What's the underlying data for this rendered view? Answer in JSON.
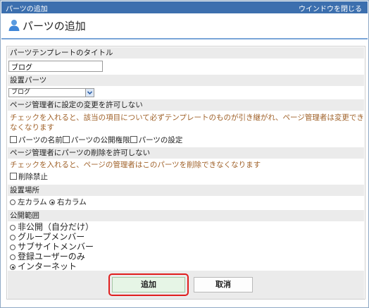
{
  "window": {
    "title": "パーツの追加",
    "close_label": "ウインドウを閉じる"
  },
  "heading": {
    "title": "パーツの追加",
    "icon": "person-icon"
  },
  "form": {
    "template_title_label": "パーツテンプレートのタイトル",
    "template_title_value": "ブログ",
    "part_label": "設置パーツ",
    "part_selected": "ブログ",
    "allow_change_label": "ページ管理者に設定の変更を許可しない",
    "allow_change_note": "チェックを入れると、該当の項目について必ずテンプレートのものが引き継がれ、ページ管理者は変更できなくなります",
    "change_options": [
      {
        "label": "パーツの名前",
        "checked": false
      },
      {
        "label": "パーツの公開権限",
        "checked": false
      },
      {
        "label": "パーツの設定",
        "checked": false
      }
    ],
    "allow_delete_label": "ページ管理者にパーツの削除を許可しない",
    "allow_delete_note": "チェックを入れると、ページの管理者はこのパーツを削除できなくなります",
    "delete_forbid_label": "削除禁止",
    "delete_forbid_checked": false,
    "location_label": "設置場所",
    "location_options": [
      {
        "label": "左カラム",
        "selected": false
      },
      {
        "label": "右カラム",
        "selected": true
      }
    ],
    "visibility_label": "公開範囲",
    "visibility_options": [
      {
        "label": "非公開（自分だけ）",
        "selected": false
      },
      {
        "label": "グループメンバー",
        "selected": false
      },
      {
        "label": "サブサイトメンバー",
        "selected": false
      },
      {
        "label": "登録ユーザーのみ",
        "selected": false
      },
      {
        "label": "インターネット",
        "selected": true
      }
    ]
  },
  "buttons": {
    "add_label": "追加",
    "cancel_label": "取消"
  },
  "colors": {
    "titlebar": "#3c6fae",
    "note_text": "#a0622a",
    "highlight": "#e01e1e"
  }
}
